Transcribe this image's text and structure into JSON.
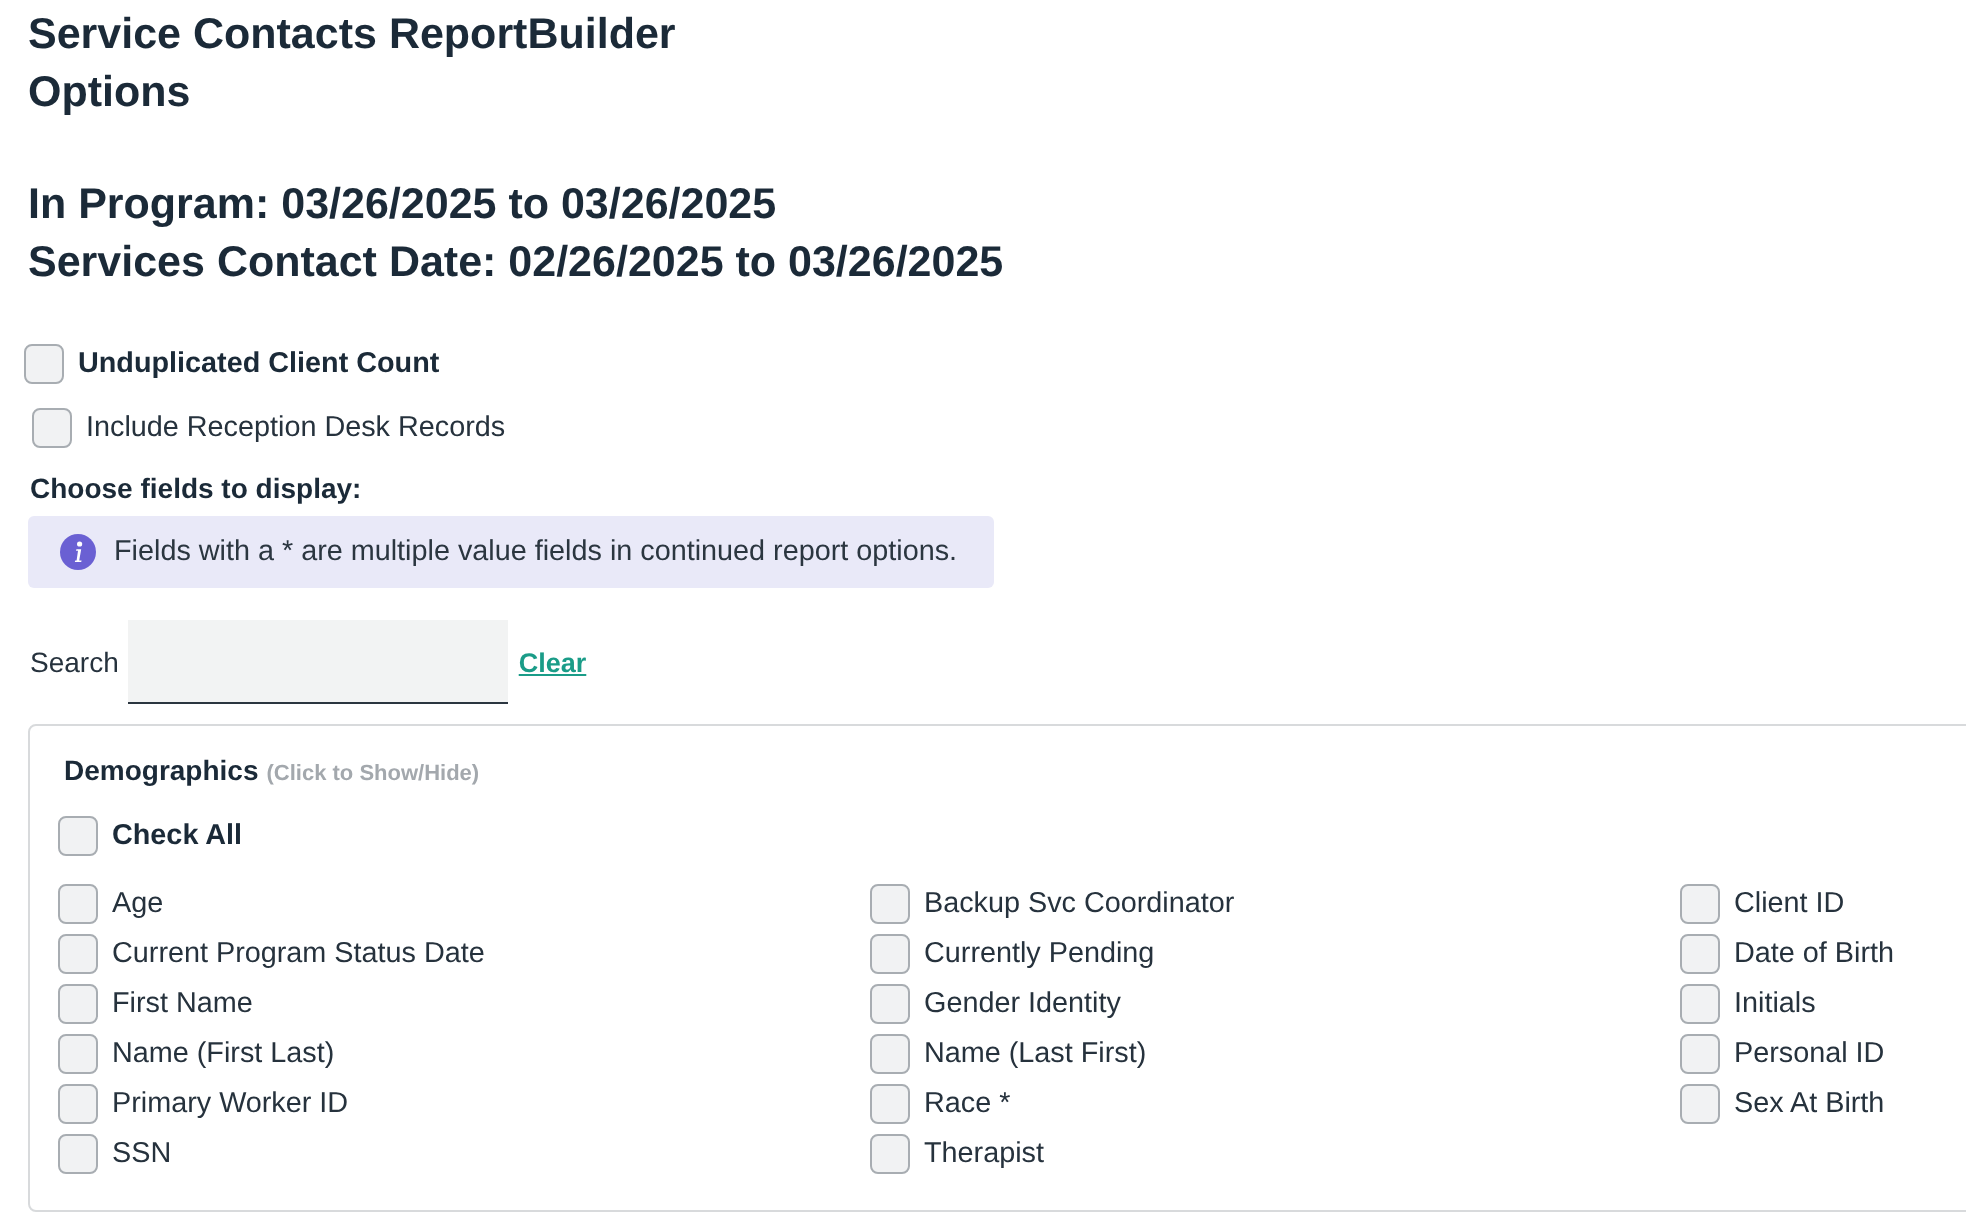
{
  "title": [
    "Service Contacts ReportBuilder",
    "Options"
  ],
  "date_ranges": [
    "In Program: 03/26/2025 to 03/26/2025",
    "Services Contact Date: 02/26/2025 to 03/26/2025"
  ],
  "unduplicated_client_count": {
    "label": "Unduplicated Client Count",
    "checked": false
  },
  "include_reception_desk_records": {
    "label": "Include Reception Desk Records",
    "checked": false
  },
  "fields_heading": "Choose fields to display:",
  "info_note": "Fields with a * are multiple value fields in continued report options.",
  "search": {
    "label": "Search",
    "clear_link": "Clear"
  },
  "sections": [
    {
      "title": "Demographics",
      "hint": "(Click to Show/Hide)",
      "check_all": {
        "label": "Check All",
        "checked": false
      },
      "fields": [
        {
          "label": "Age",
          "checked": false
        },
        {
          "label": "Backup Svc Coordinator",
          "checked": false
        },
        {
          "label": "Client ID",
          "checked": false
        },
        {
          "label": "Current Program Status Date",
          "checked": false
        },
        {
          "label": "Currently Pending",
          "checked": false
        },
        {
          "label": "Date of Birth",
          "checked": false
        },
        {
          "label": "First Name",
          "checked": false
        },
        {
          "label": "Gender Identity",
          "checked": false
        },
        {
          "label": "Initials",
          "checked": false
        },
        {
          "label": "Name (First Last)",
          "checked": false
        },
        {
          "label": "Name (Last First)",
          "checked": false
        },
        {
          "label": "Personal ID",
          "checked": false
        },
        {
          "label": "Primary Worker ID",
          "checked": false
        },
        {
          "label": "Race *",
          "checked": false
        },
        {
          "label": "Sex At Birth",
          "checked": false
        },
        {
          "label": "SSN",
          "checked": false
        },
        {
          "label": "Therapist",
          "checked": false
        }
      ]
    }
  ]
}
